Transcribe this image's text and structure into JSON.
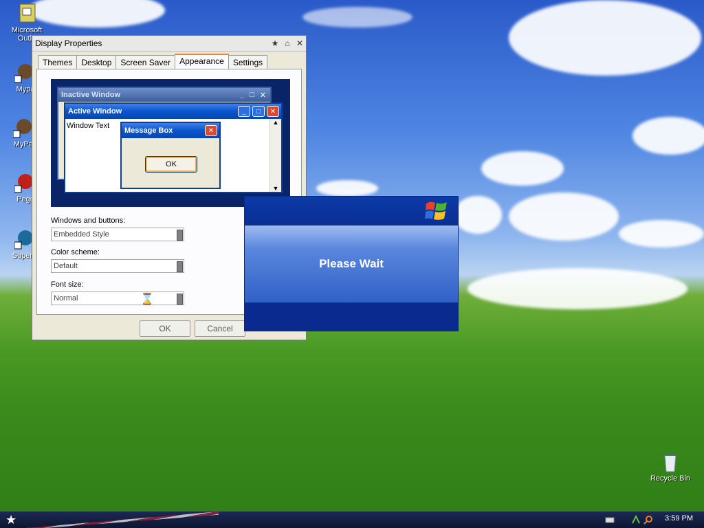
{
  "desktop": {
    "icons": [
      {
        "label": "Microsoft Outlo",
        "icon": "outlook-icon"
      },
      {
        "label": "Mypa",
        "icon": "shortcut-icon"
      },
      {
        "label": "MyPal",
        "icon": "shortcut-icon"
      },
      {
        "label": "Pego",
        "icon": "shortcut-icon"
      },
      {
        "label": "Superm",
        "icon": "shortcut-icon"
      },
      {
        "label": "Recycle Bin",
        "icon": "recycle-bin-icon"
      }
    ]
  },
  "display_properties": {
    "title": "Display Properties",
    "tabs": [
      "Themes",
      "Desktop",
      "Screen Saver",
      "Appearance",
      "Settings"
    ],
    "active_tab": "Appearance",
    "preview": {
      "inactive_title": "Inactive Window",
      "active_title": "Active Window",
      "window_text": "Window Text",
      "message_box_title": "Message Box",
      "message_box_ok": "OK"
    },
    "windows_and_buttons_label": "Windows and buttons:",
    "windows_and_buttons_value": "Embedded Style",
    "color_scheme_label": "Color scheme:",
    "color_scheme_value": "Default",
    "font_size_label": "Font size:",
    "font_size_value": "Normal",
    "ok_label": "OK",
    "cancel_label": "Cancel"
  },
  "please_wait": {
    "message": "Please Wait"
  },
  "taskbar": {
    "clock": "3:59 PM"
  },
  "colors": {
    "xp_blue": "#0a55cc",
    "close_red": "#d94a32",
    "focus_orange": "#e68b2c"
  }
}
